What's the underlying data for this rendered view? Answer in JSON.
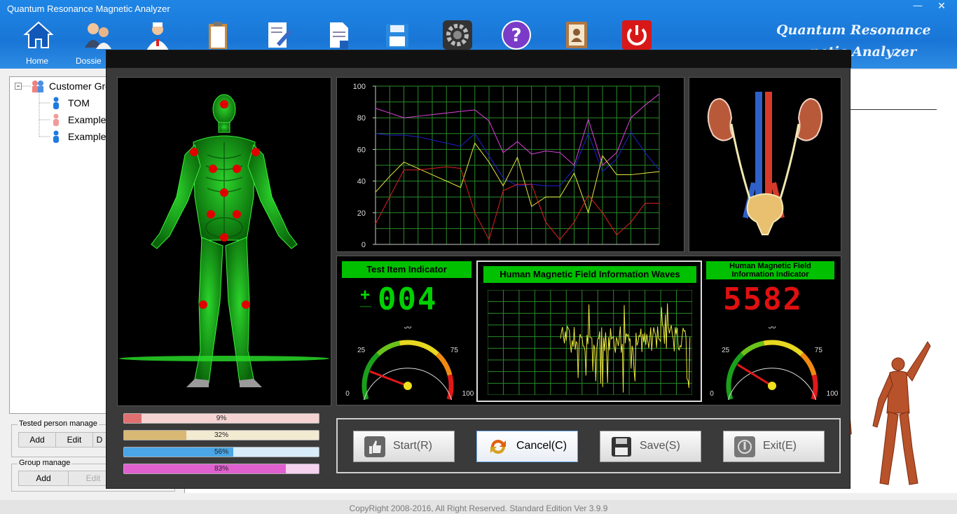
{
  "window": {
    "title": "Quantum Resonance Magnetic Analyzer",
    "minimize_glyph": "—",
    "close_glyph": "✕"
  },
  "toolbar": {
    "items": [
      {
        "label": "Home",
        "icon": "home-icon"
      },
      {
        "label": "Dossie",
        "icon": "users-icon"
      },
      {
        "label": "",
        "icon": "doctor-icon"
      },
      {
        "label": "",
        "icon": "clipboard-icon"
      },
      {
        "label": "",
        "icon": "edit-document-icon"
      },
      {
        "label": "",
        "icon": "document-icon"
      },
      {
        "label": "",
        "icon": "save-icon"
      },
      {
        "label": "",
        "icon": "gear-icon"
      },
      {
        "label": "",
        "icon": "help-icon"
      },
      {
        "label": "",
        "icon": "contacts-book-icon"
      },
      {
        "label": "",
        "icon": "power-icon"
      }
    ],
    "brand_line1": "Quantum Resonance",
    "brand_line2": "netic Analyzer"
  },
  "tree": {
    "root": "Customer Gro",
    "children": [
      {
        "label": "TOM",
        "color": "#1e7be0"
      },
      {
        "label": "Example",
        "color": "#f29a9a"
      },
      {
        "label": "Example",
        "color": "#1e7be0"
      }
    ]
  },
  "tested_person_manage": {
    "label": "Tested person manage",
    "buttons": [
      "Add",
      "Edit",
      "D"
    ]
  },
  "group_manage": {
    "label": "Group manage",
    "buttons": [
      "Add",
      "Edit"
    ]
  },
  "footer": {
    "copyright": "CopyRight 2008-2016, All Right Reserved.  Standard Edition Ver 3.9.9"
  },
  "progress": [
    {
      "label": "9%",
      "value": 0.09,
      "color": "#e07070",
      "track": "#f6d3d3"
    },
    {
      "label": "32%",
      "value": 0.32,
      "color": "#d8b872",
      "track": "#f3ead2"
    },
    {
      "label": "56%",
      "value": 0.56,
      "color": "#4aa6e6",
      "track": "#d7ecf8"
    },
    {
      "label": "83%",
      "value": 0.83,
      "color": "#e060d0",
      "track": "#f5d3ef"
    }
  ],
  "chart_data": {
    "type": "line",
    "x": [
      0,
      1,
      2,
      3,
      4,
      5,
      6,
      7,
      8,
      9,
      10,
      11,
      12,
      13,
      14,
      15,
      16,
      17,
      18,
      19,
      20
    ],
    "ylim": [
      0,
      100
    ],
    "y_ticks": [
      "0",
      "20",
      "40",
      "60",
      "80",
      "100"
    ],
    "grid": true,
    "series": [
      {
        "color": "#e040e0",
        "values": [
          86,
          83,
          80,
          81,
          82,
          83,
          84,
          85,
          78,
          58,
          65,
          57,
          59,
          58,
          50,
          79,
          50,
          58,
          80,
          88,
          95
        ]
      },
      {
        "color": "#2020d0",
        "values": [
          70,
          69,
          69,
          68,
          66,
          64,
          62,
          70,
          56,
          42,
          37,
          38,
          37,
          37,
          48,
          70,
          46,
          54,
          71,
          58,
          47
        ]
      },
      {
        "color": "#e8e840",
        "values": [
          33,
          43,
          52,
          48,
          44,
          40,
          36,
          64,
          52,
          37,
          55,
          24,
          30,
          30,
          45,
          20,
          56,
          44,
          44,
          45,
          46
        ]
      },
      {
        "color": "#e02020",
        "values": [
          13,
          30,
          47,
          47,
          48,
          49,
          48,
          20,
          3,
          34,
          38,
          38,
          14,
          3,
          14,
          31,
          20,
          6,
          14,
          26,
          26
        ]
      }
    ]
  },
  "test_item": {
    "title": "Test Item Indicator",
    "plus": "+",
    "minus": "—",
    "digits": "004",
    "needle": 0.18
  },
  "wave": {
    "title": "Human Magnetic Field Information Waves",
    "line_color": "#e8e840"
  },
  "magnetic_field": {
    "title_line1": "Human Magnetic Field",
    "title_line2": "Information Indicator",
    "digits": "5582",
    "needle": 0.23
  },
  "gauge_labels": [
    "0",
    "25",
    "50",
    "75",
    "100"
  ],
  "buttons": [
    {
      "label": "Start(R)",
      "icon": "thumb-up-icon",
      "selected": false
    },
    {
      "label": "Cancel(C)",
      "icon": "refresh-icon",
      "selected": true
    },
    {
      "label": "Save(S)",
      "icon": "floppy-icon",
      "selected": false
    },
    {
      "label": "Exit(E)",
      "icon": "exit-icon",
      "selected": false
    }
  ],
  "body_points_color": "#e00000",
  "body_color": "#18b818"
}
